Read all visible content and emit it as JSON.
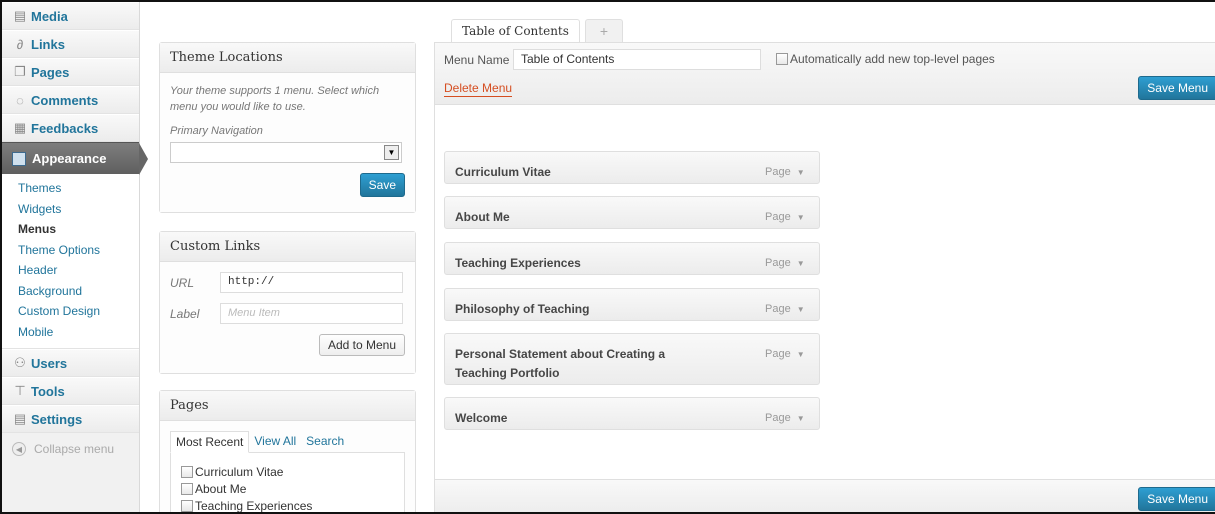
{
  "sidebar": {
    "items_top": [
      {
        "label": "Media",
        "icon": "media-icon",
        "glyph": "▤"
      },
      {
        "label": "Links",
        "icon": "links-icon",
        "glyph": "∂"
      },
      {
        "label": "Pages",
        "icon": "pages-icon",
        "glyph": "❐"
      },
      {
        "label": "Comments",
        "icon": "comments-icon",
        "glyph": "◌"
      },
      {
        "label": "Feedbacks",
        "icon": "feedbacks-icon",
        "glyph": "▦"
      }
    ],
    "current": {
      "label": "Appearance",
      "icon": "appearance-icon"
    },
    "submenu": [
      "Themes",
      "Widgets",
      "Menus",
      "Theme Options",
      "Header",
      "Background",
      "Custom Design",
      "Mobile"
    ],
    "submenu_current": "Menus",
    "items_bottom": [
      {
        "label": "Users",
        "icon": "users-icon",
        "glyph": "⚇"
      },
      {
        "label": "Tools",
        "icon": "tools-icon",
        "glyph": "⊤"
      },
      {
        "label": "Settings",
        "icon": "settings-icon",
        "glyph": "▤"
      }
    ],
    "collapse_label": "Collapse menu"
  },
  "theme_locations": {
    "title": "Theme Locations",
    "description": "Your theme supports 1 menu. Select which menu you would like to use.",
    "location_label": "Primary Navigation",
    "selected_value": "",
    "save_label": "Save"
  },
  "custom_links": {
    "title": "Custom Links",
    "url_label": "URL",
    "url_value": "http://",
    "label_label": "Label",
    "label_placeholder": "Menu Item",
    "add_button": "Add to Menu"
  },
  "pages_box": {
    "title": "Pages",
    "tabs": [
      "Most Recent",
      "View All",
      "Search"
    ],
    "active_tab": "Most Recent",
    "items": [
      "Curriculum Vitae",
      "About Me",
      "Teaching Experiences"
    ]
  },
  "menu_tabs": {
    "active_tab": "Table of Contents",
    "add_tab": "+"
  },
  "editor": {
    "menu_name_label": "Menu Name",
    "menu_name_value": "Table of Contents",
    "auto_add_label": "Automatically add new top-level pages",
    "delete_label": "Delete Menu",
    "save_label": "Save Menu",
    "items": [
      {
        "title": "Curriculum Vitae",
        "type": "Page"
      },
      {
        "title": "About Me",
        "type": "Page"
      },
      {
        "title": "Teaching Experiences",
        "type": "Page"
      },
      {
        "title": "Philosophy of Teaching",
        "type": "Page"
      },
      {
        "title": "Personal Statement about Creating a Teaching Portfolio",
        "type": "Page"
      },
      {
        "title": "Welcome",
        "type": "Page"
      }
    ]
  },
  "colors": {
    "accent": "#21759b",
    "delete": "#d54e21",
    "sidebar_current": "#6d6d6d"
  }
}
